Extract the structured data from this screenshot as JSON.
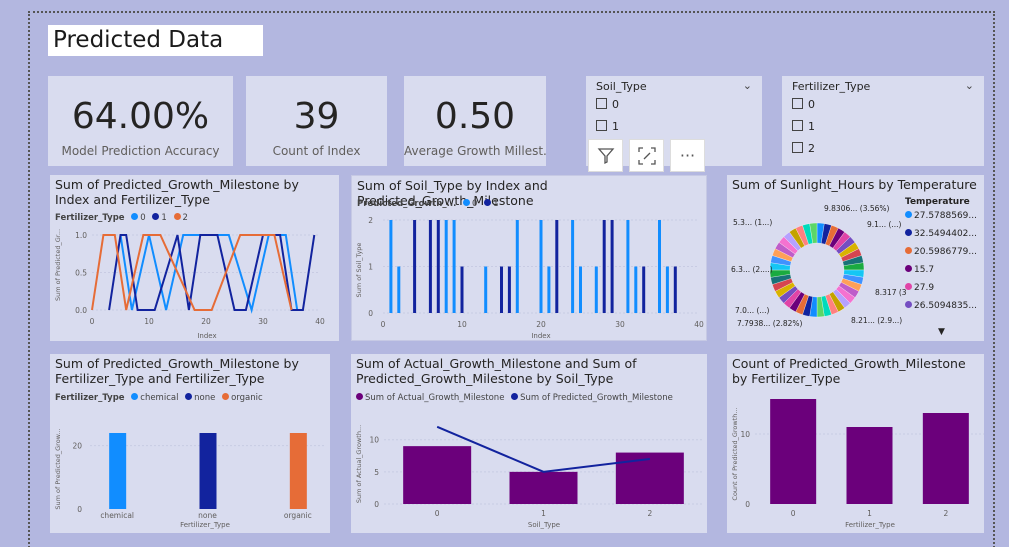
{
  "page_title": "Predicted Data",
  "kpis": [
    {
      "value": "64.00%",
      "label": "Model Prediction Accuracy"
    },
    {
      "value": "39",
      "label": "Count of Index"
    },
    {
      "value": "0.50",
      "label": "Average Growth Millest..."
    }
  ],
  "slicers": [
    {
      "title": "Soil_Type",
      "items": [
        "0",
        "1",
        "2"
      ]
    },
    {
      "title": "Fertilizer_Type",
      "items": [
        "0",
        "1",
        "2"
      ]
    }
  ],
  "toolbar": {
    "more_label": "···"
  },
  "colors": {
    "series0": "#118dff",
    "series1": "#12239e",
    "series2": "#e66c37",
    "purple": "#6b007b",
    "card_bg": "#d9dcef",
    "page_bg": "#b3b7e0"
  },
  "visuals": {
    "v1": {
      "title": "Sum of Predicted_Growth_Milestone by Index and Fertilizer_Type",
      "legend_title": "Fertilizer_Type",
      "legend": [
        "0",
        "1",
        "2"
      ],
      "y_label": "Sum of Predicted_Gr...",
      "x_label": "Index",
      "y_ticks": [
        "1.0",
        "0.5",
        "0.0"
      ],
      "x_ticks": [
        "0",
        "10",
        "20",
        "30",
        "40"
      ]
    },
    "v2": {
      "title": "Sum of Soil_Type by Index and Predicted_Growth_Milestone",
      "legend_title": "Predicted_Growth_...",
      "legend": [
        "0",
        "1"
      ],
      "y_label": "Sum of Soil_Type",
      "x_label": "Index",
      "y_ticks": [
        "2",
        "1",
        "0"
      ],
      "x_ticks": [
        "0",
        "10",
        "20",
        "30",
        "40"
      ]
    },
    "v3": {
      "title": "Sum of Sunlight_Hours by Temperature",
      "legend_title": "Temperature",
      "legend": [
        "27.5788569...",
        "32.5494402...",
        "20.5986779...",
        "15.7",
        "27.9",
        "26.5094835..."
      ],
      "labels": [
        "9.8306... (3.56%)",
        "9.1... (...)",
        "5.3... (1...)",
        "6.3... (2....)",
        "7.0... (...)",
        "7.7938... (2.82%)",
        "8.21... (2.9...)",
        "8.317 (3.01...)"
      ]
    },
    "v4": {
      "title": "Sum of Predicted_Growth_Milestone by Fertilizer_Type and Fertilizer_Type",
      "legend_title": "Fertilizer_Type",
      "legend": [
        "chemical",
        "none",
        "organic"
      ],
      "y_label": "Sum of Predicted_Grow...",
      "x_label": "Fertilizer_Type",
      "y_ticks": [
        "20",
        "0"
      ]
    },
    "v5": {
      "title": "Sum of Actual_Growth_Milestone and Sum of Predicted_Growth_Milestone by Soil_Type",
      "legend": [
        "Sum of Actual_Growth_Milestone",
        "Sum of Predicted_Growth_Milestone"
      ],
      "y_label": "Sum of Actual_Growth...",
      "x_label": "Soil_Type",
      "y_ticks": [
        "10",
        "5",
        "0"
      ]
    },
    "v6": {
      "title": "Count of Predicted_Growth_Milestone by Fertilizer_Type",
      "y_label": "Count of Predicted_Growth...",
      "x_label": "Fertilizer_Type",
      "y_ticks": [
        "10",
        "0"
      ]
    }
  },
  "chart_data": [
    {
      "type": "line",
      "title": "Sum of Predicted_Growth_Milestone by Index and Fertilizer_Type",
      "xlabel": "Index",
      "ylabel": "Sum of Predicted_Gr...",
      "xlim": [
        0,
        40
      ],
      "ylim": [
        0,
        1
      ],
      "series": [
        {
          "name": "0",
          "x": [
            5,
            7,
            10,
            13,
            16,
            20,
            24,
            28,
            31,
            34,
            36
          ],
          "y": [
            1,
            0,
            1,
            0,
            1,
            1,
            1,
            0,
            1,
            1,
            0
          ]
        },
        {
          "name": "1",
          "x": [
            3,
            5,
            6,
            8,
            11,
            15,
            17,
            19,
            22,
            25,
            27,
            30,
            33,
            35,
            37,
            39
          ],
          "y": [
            0,
            1,
            1,
            0,
            0,
            1,
            0,
            1,
            1,
            0,
            0,
            1,
            1,
            0,
            0,
            1
          ]
        },
        {
          "name": "2",
          "x": [
            0,
            2,
            4,
            6,
            9,
            12,
            18,
            21,
            26,
            29,
            32,
            35
          ],
          "y": [
            0,
            1,
            1,
            0,
            1,
            1,
            0,
            0,
            1,
            1,
            1,
            0
          ]
        }
      ]
    },
    {
      "type": "bar",
      "title": "Sum of Soil_Type by Index and Predicted_Growth_Milestone",
      "xlabel": "Index",
      "ylabel": "Sum of Soil_Type",
      "xlim": [
        0,
        40
      ],
      "ylim": [
        0,
        2
      ],
      "series": [
        {
          "name": "0",
          "x": [
            1,
            2,
            8,
            9,
            13,
            17,
            20,
            21,
            24,
            25,
            27,
            31,
            32,
            35,
            36
          ],
          "values": [
            2,
            1,
            2,
            2,
            1,
            2,
            2,
            1,
            2,
            1,
            1,
            2,
            1,
            2,
            1
          ]
        },
        {
          "name": "1",
          "x": [
            4,
            6,
            7,
            10,
            15,
            16,
            22,
            28,
            29,
            33,
            37
          ],
          "values": [
            2,
            2,
            2,
            1,
            1,
            1,
            2,
            2,
            2,
            1,
            1
          ]
        }
      ]
    },
    {
      "type": "pie",
      "title": "Sum of Sunlight_Hours by Temperature",
      "legend_title": "Temperature",
      "categories": [
        "9.8306...",
        "9.1...",
        "8.317",
        "8.21...",
        "7.7938...",
        "7.0...",
        "6.3...",
        "5.3..."
      ],
      "values": [
        3.56,
        3.3,
        3.01,
        2.9,
        2.82,
        2.5,
        2.3,
        1.9
      ]
    },
    {
      "type": "bar",
      "title": "Sum of Predicted_Growth_Milestone by Fertilizer_Type and Fertilizer_Type",
      "xlabel": "Fertilizer_Type",
      "ylabel": "Sum of Predicted_Grow...",
      "categories": [
        "chemical",
        "none",
        "organic"
      ],
      "values": [
        24,
        24,
        24
      ],
      "ylim": [
        0,
        30
      ]
    },
    {
      "type": "bar",
      "title": "Sum of Actual_Growth_Milestone and Sum of Predicted_Growth_Milestone by Soil_Type",
      "xlabel": "Soil_Type",
      "ylabel": "Sum of Actual_Growth...",
      "categories": [
        "0",
        "1",
        "2"
      ],
      "series": [
        {
          "name": "Sum of Actual_Growth_Milestone",
          "values": [
            9,
            5,
            8
          ]
        },
        {
          "name": "Sum of Predicted_Growth_Milestone",
          "values": [
            12,
            5,
            7
          ]
        }
      ],
      "ylim": [
        0,
        14
      ]
    },
    {
      "type": "bar",
      "title": "Count of Predicted_Growth_Milestone by Fertilizer_Type",
      "xlabel": "Fertilizer_Type",
      "ylabel": "Count of Predicted_Growth...",
      "categories": [
        "0",
        "1",
        "2"
      ],
      "values": [
        15,
        11,
        13
      ],
      "ylim": [
        0,
        16
      ]
    }
  ]
}
